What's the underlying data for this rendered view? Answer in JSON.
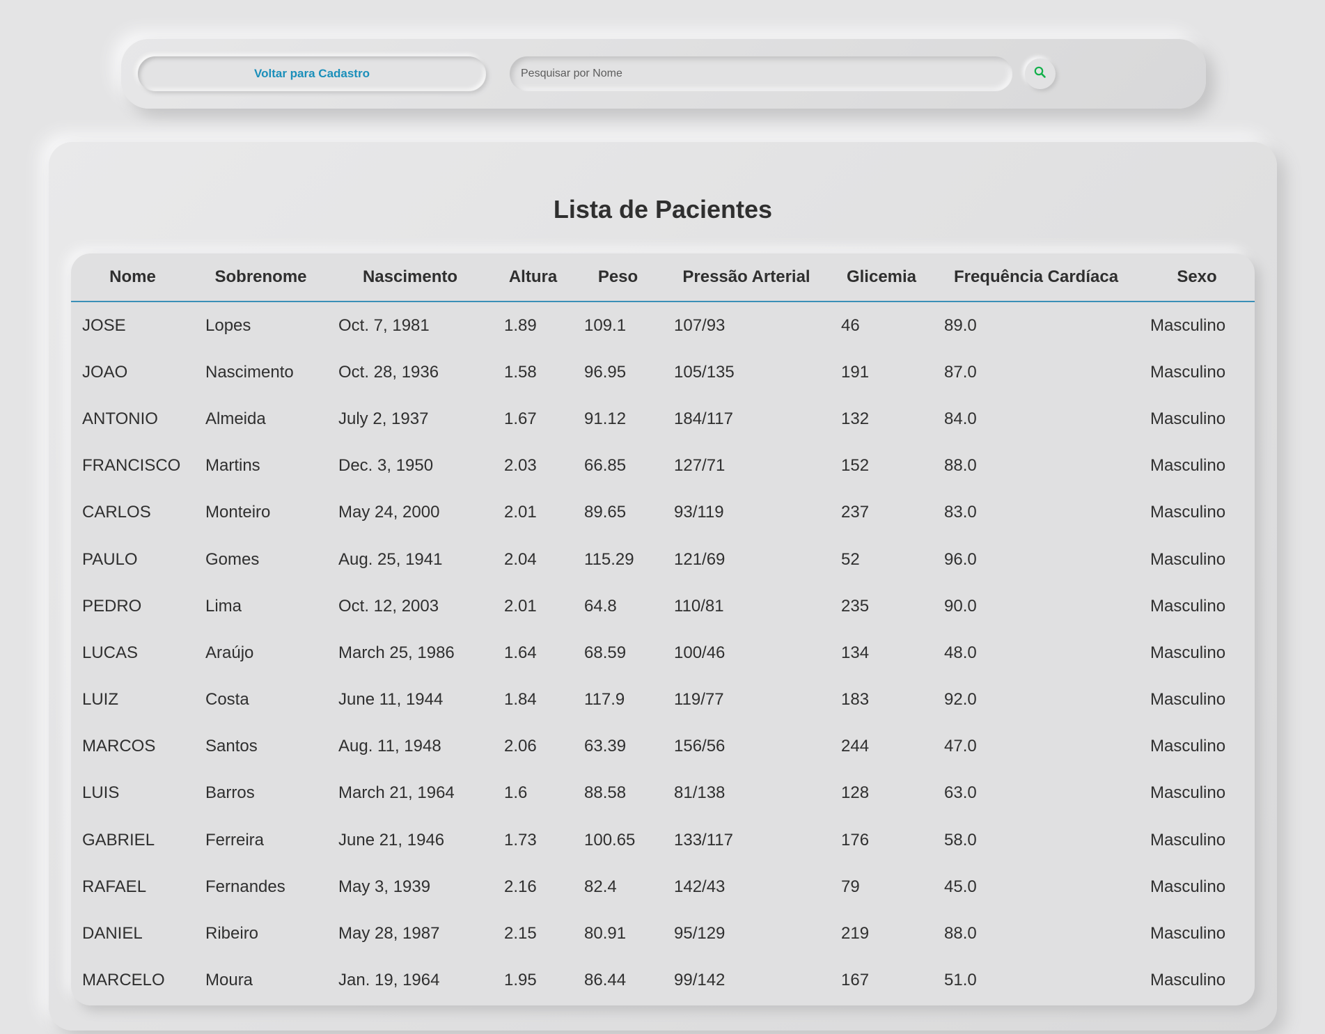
{
  "toolbar": {
    "back_label": "Voltar para Cadastro",
    "search_placeholder": "Pesquisar por Nome",
    "search_icon": "search-icon",
    "accent_color": "#1b8fba",
    "search_icon_color": "#12b04a"
  },
  "page": {
    "title": "Lista de Pacientes"
  },
  "table": {
    "columns": [
      "Nome",
      "Sobrenome",
      "Nascimento",
      "Altura",
      "Peso",
      "Pressão Arterial",
      "Glicemia",
      "Frequência Cardíaca",
      "Sexo"
    ],
    "rows": [
      [
        "JOSE",
        "Lopes",
        "Oct. 7, 1981",
        "1.89",
        "109.1",
        "107/93",
        "46",
        "89.0",
        "Masculino"
      ],
      [
        "JOAO",
        "Nascimento",
        "Oct. 28, 1936",
        "1.58",
        "96.95",
        "105/135",
        "191",
        "87.0",
        "Masculino"
      ],
      [
        "ANTONIO",
        "Almeida",
        "July 2, 1937",
        "1.67",
        "91.12",
        "184/117",
        "132",
        "84.0",
        "Masculino"
      ],
      [
        "FRANCISCO",
        "Martins",
        "Dec. 3, 1950",
        "2.03",
        "66.85",
        "127/71",
        "152",
        "88.0",
        "Masculino"
      ],
      [
        "CARLOS",
        "Monteiro",
        "May 24, 2000",
        "2.01",
        "89.65",
        "93/119",
        "237",
        "83.0",
        "Masculino"
      ],
      [
        "PAULO",
        "Gomes",
        "Aug. 25, 1941",
        "2.04",
        "115.29",
        "121/69",
        "52",
        "96.0",
        "Masculino"
      ],
      [
        "PEDRO",
        "Lima",
        "Oct. 12, 2003",
        "2.01",
        "64.8",
        "110/81",
        "235",
        "90.0",
        "Masculino"
      ],
      [
        "LUCAS",
        "Araújo",
        "March 25, 1986",
        "1.64",
        "68.59",
        "100/46",
        "134",
        "48.0",
        "Masculino"
      ],
      [
        "LUIZ",
        "Costa",
        "June 11, 1944",
        "1.84",
        "117.9",
        "119/77",
        "183",
        "92.0",
        "Masculino"
      ],
      [
        "MARCOS",
        "Santos",
        "Aug. 11, 1948",
        "2.06",
        "63.39",
        "156/56",
        "244",
        "47.0",
        "Masculino"
      ],
      [
        "LUIS",
        "Barros",
        "March 21, 1964",
        "1.6",
        "88.58",
        "81/138",
        "128",
        "63.0",
        "Masculino"
      ],
      [
        "GABRIEL",
        "Ferreira",
        "June 21, 1946",
        "1.73",
        "100.65",
        "133/117",
        "176",
        "58.0",
        "Masculino"
      ],
      [
        "RAFAEL",
        "Fernandes",
        "May 3, 1939",
        "2.16",
        "82.4",
        "142/43",
        "79",
        "45.0",
        "Masculino"
      ],
      [
        "DANIEL",
        "Ribeiro",
        "May 28, 1987",
        "2.15",
        "80.91",
        "95/129",
        "219",
        "88.0",
        "Masculino"
      ],
      [
        "MARCELO",
        "Moura",
        "Jan. 19, 1964",
        "1.95",
        "86.44",
        "99/142",
        "167",
        "51.0",
        "Masculino"
      ]
    ]
  }
}
